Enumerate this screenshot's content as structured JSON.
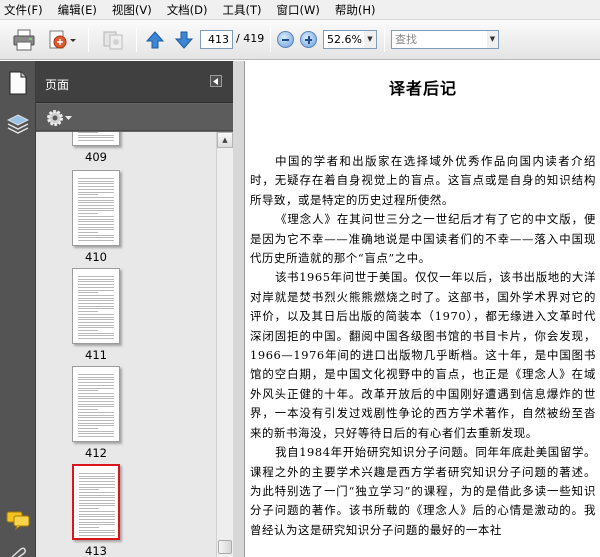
{
  "menu": {
    "items": [
      {
        "name": "menu-file",
        "label": "文件(F)"
      },
      {
        "name": "menu-edit",
        "label": "编辑(E)"
      },
      {
        "name": "menu-view",
        "label": "视图(V)"
      },
      {
        "name": "menu-document",
        "label": "文档(D)"
      },
      {
        "name": "menu-tools",
        "label": "工具(T)"
      },
      {
        "name": "menu-window",
        "label": "窗口(W)"
      },
      {
        "name": "menu-help",
        "label": "帮助(H)"
      }
    ]
  },
  "toolbar": {
    "current_page": "413",
    "page_total": "/ 419",
    "zoom": "52.6%",
    "search_placeholder": "查找"
  },
  "panel": {
    "title": "页面",
    "thumbnails": [
      {
        "label": "409"
      },
      {
        "label": "410"
      },
      {
        "label": "411"
      },
      {
        "label": "412"
      },
      {
        "label": "413",
        "selected": true
      }
    ]
  },
  "document": {
    "title": "译者后记",
    "paragraphs": [
      "中国的学者和出版家在选择域外优秀作品向国内读者介绍时，无疑存在着自身视觉上的盲点。这盲点或是自身的知识结构所导致，或是特定的历史过程所使然。",
      "《理念人》在其问世三分之一世纪后才有了它的中文版，便是因为它不幸——准确地说是中国读者们的不幸——落入中国现代历史所造就的那个“盲点”之中。",
      "该书1965年问世于美国。仅仅一年以后，该书出版地的大洋对岸就是焚书烈火熊熊燃烧之时了。这部书，国外学术界对它的评价，以及其日后出版的简装本（1970），都无缘进入文革时代深闭固拒的中国。翻阅中国各级图书馆的书目卡片，你会发现，1966—1976年间的进口出版物几乎断档。这十年，是中国图书馆的空白期，是中国文化视野中的盲点，也正是《理念人》在域外风头正健的十年。改革开放后的中国刚好遭遇到信息爆炸的世界，一本没有引发过戏剧性争论的西方学术著作，自然被纷至沓来的新书海没，只好等待日后的有心者们去重新发现。",
      "我自1984年开始研究知识分子问题。同年年底赴美国留学。课程之外的主要学术兴趣是西方学者研究知识分子问题的著述。为此特别选了一门“独立学习”的课程，为的是借此多读一些知识分子问题的著作。该书所载的《理念人》后的心情是激动的。我曾经认为这是研究知识分子问题的最好的一本社"
    ]
  }
}
